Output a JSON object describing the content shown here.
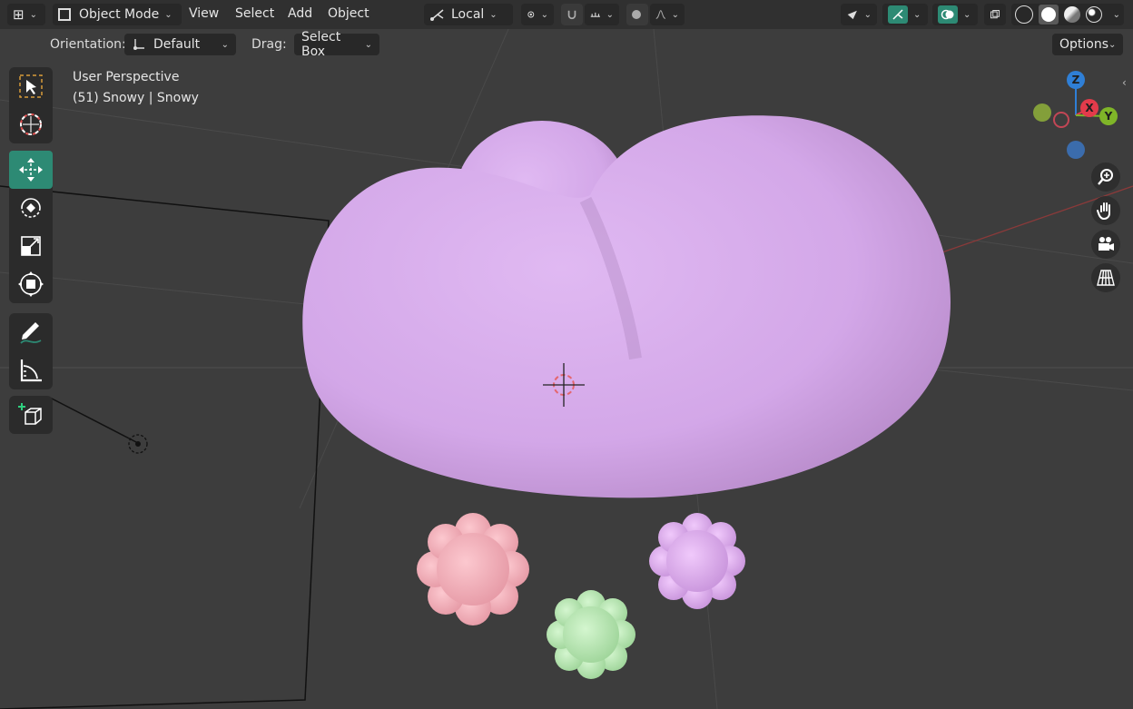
{
  "header": {
    "mode_label": "Object Mode",
    "menu": [
      "View",
      "Select",
      "Add",
      "Object"
    ],
    "transform_orientation": "Local",
    "options_label": "Options"
  },
  "tool_settings": {
    "orientation_label": "Orientation:",
    "orientation_value": "Default",
    "drag_label": "Drag:",
    "drag_value": "Select Box"
  },
  "viewport": {
    "view_name": "User Perspective",
    "object_info": "(51) Snowy | Snowy"
  },
  "gizmo": {
    "axes": {
      "z": "Z",
      "x": "X",
      "y": "Y"
    },
    "colors": {
      "z": "#2f7fd6",
      "x": "#e23b4b",
      "y": "#7fb528",
      "neg_y": "#8fb03a",
      "neg_z": "#3b71b8"
    }
  },
  "toolbar": {
    "tools": [
      "select-box",
      "cursor",
      "move",
      "rotate",
      "scale",
      "transform",
      "annotate",
      "measure",
      "add-cube"
    ],
    "active_tool": "move",
    "active_color": "#2d8a74"
  },
  "scene": {
    "cloud_color": "#d2a6e6",
    "drops": [
      {
        "name": "pink",
        "color": "#f6b6c0"
      },
      {
        "name": "purple",
        "color": "#e2b0f0"
      },
      {
        "name": "green",
        "color": "#bde9b8"
      }
    ]
  }
}
